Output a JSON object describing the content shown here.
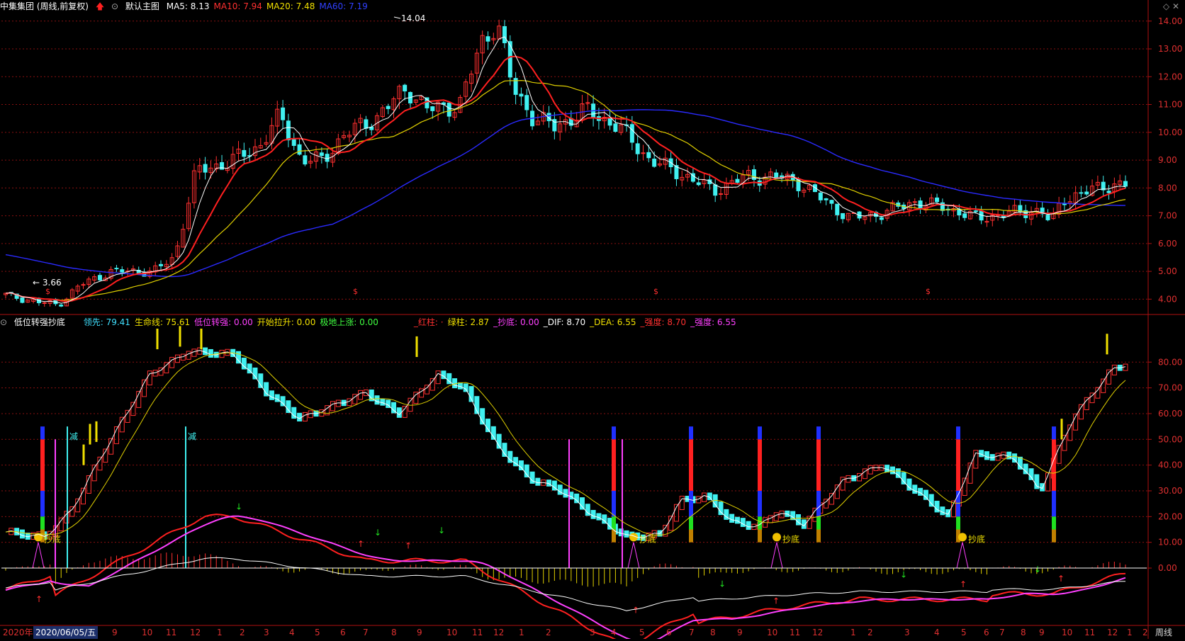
{
  "main_pane": {
    "title": "中集集团 (周线,前复权)",
    "template": "默认主图",
    "ma": [
      {
        "label": "MA5: 8.13",
        "color": "#ffffff"
      },
      {
        "label": "MA10: 7.94",
        "color": "#ff3030"
      },
      {
        "label": "MA20: 7.48",
        "color": "#f0e000"
      },
      {
        "label": "MA60: 7.19",
        "color": "#3040ff"
      }
    ],
    "high_label": "14.04",
    "low_label": "3.66"
  },
  "sub_pane": {
    "title": "低位转强抄底",
    "stats": [
      {
        "label": "领先: 79.41",
        "color": "#40e0ff"
      },
      {
        "label": "生命线: 75.61",
        "color": "#f0e000"
      },
      {
        "label": "低位转强: 0.00",
        "color": "#ff40ff"
      },
      {
        "label": "开始拉升: 0.00",
        "color": "#f0e000"
      },
      {
        "label": "极地上涨: 0.00",
        "color": "#40ff40"
      },
      {
        "label": "_红柱: ·",
        "color": "#ff3030"
      },
      {
        "label": "绿柱: 2.87",
        "color": "#f0e000"
      },
      {
        "label": "_抄底: 0.00",
        "color": "#ff40ff"
      },
      {
        "label": "_DIF: 8.70",
        "color": "#ffffff"
      },
      {
        "label": "_DEA: 6.55",
        "color": "#f0e000"
      },
      {
        "label": "_强度: 8.70",
        "color": "#ff3030"
      },
      {
        "label": "_强度: 6.55",
        "color": "#ff40ff"
      }
    ],
    "jian_label": "减",
    "chaodi_label": "抄底"
  },
  "right_axis": {
    "main_ticks": [
      "14.00",
      "13.00",
      "12.00",
      "11.00",
      "10.00",
      "9.00",
      "8.00",
      "7.00",
      "6.00",
      "5.00",
      "4.00"
    ],
    "sub_ticks": [
      "80.00",
      "70.00",
      "60.00",
      "50.00",
      "40.00",
      "30.00",
      "20.00",
      "10.00",
      "0.00"
    ]
  },
  "time_axis": {
    "year_label": "2020年",
    "selected_date": "2020/06/05/五",
    "months": [
      "9",
      "10",
      "11",
      "12",
      "1",
      "2",
      "3",
      "4",
      "5",
      "6",
      "7",
      "8",
      "9",
      "10",
      "11",
      "12",
      "1",
      "2",
      "3",
      "4",
      "5",
      "6",
      "7",
      "8",
      "9",
      "10",
      "11",
      "12",
      "1",
      "2",
      "3",
      "4",
      "5",
      "6",
      "7",
      "8",
      "9",
      "10",
      "11",
      "12",
      "1",
      "2"
    ],
    "period": "周线"
  },
  "markers": {
    "dollar": "$"
  },
  "colors": {
    "up": "#ff3030",
    "down": "#40f0f0",
    "ma5": "#ffffff",
    "ma10": "#ff2020",
    "ma20": "#e0d000",
    "ma60": "#2a2aff",
    "grid": "#8a1010"
  }
}
